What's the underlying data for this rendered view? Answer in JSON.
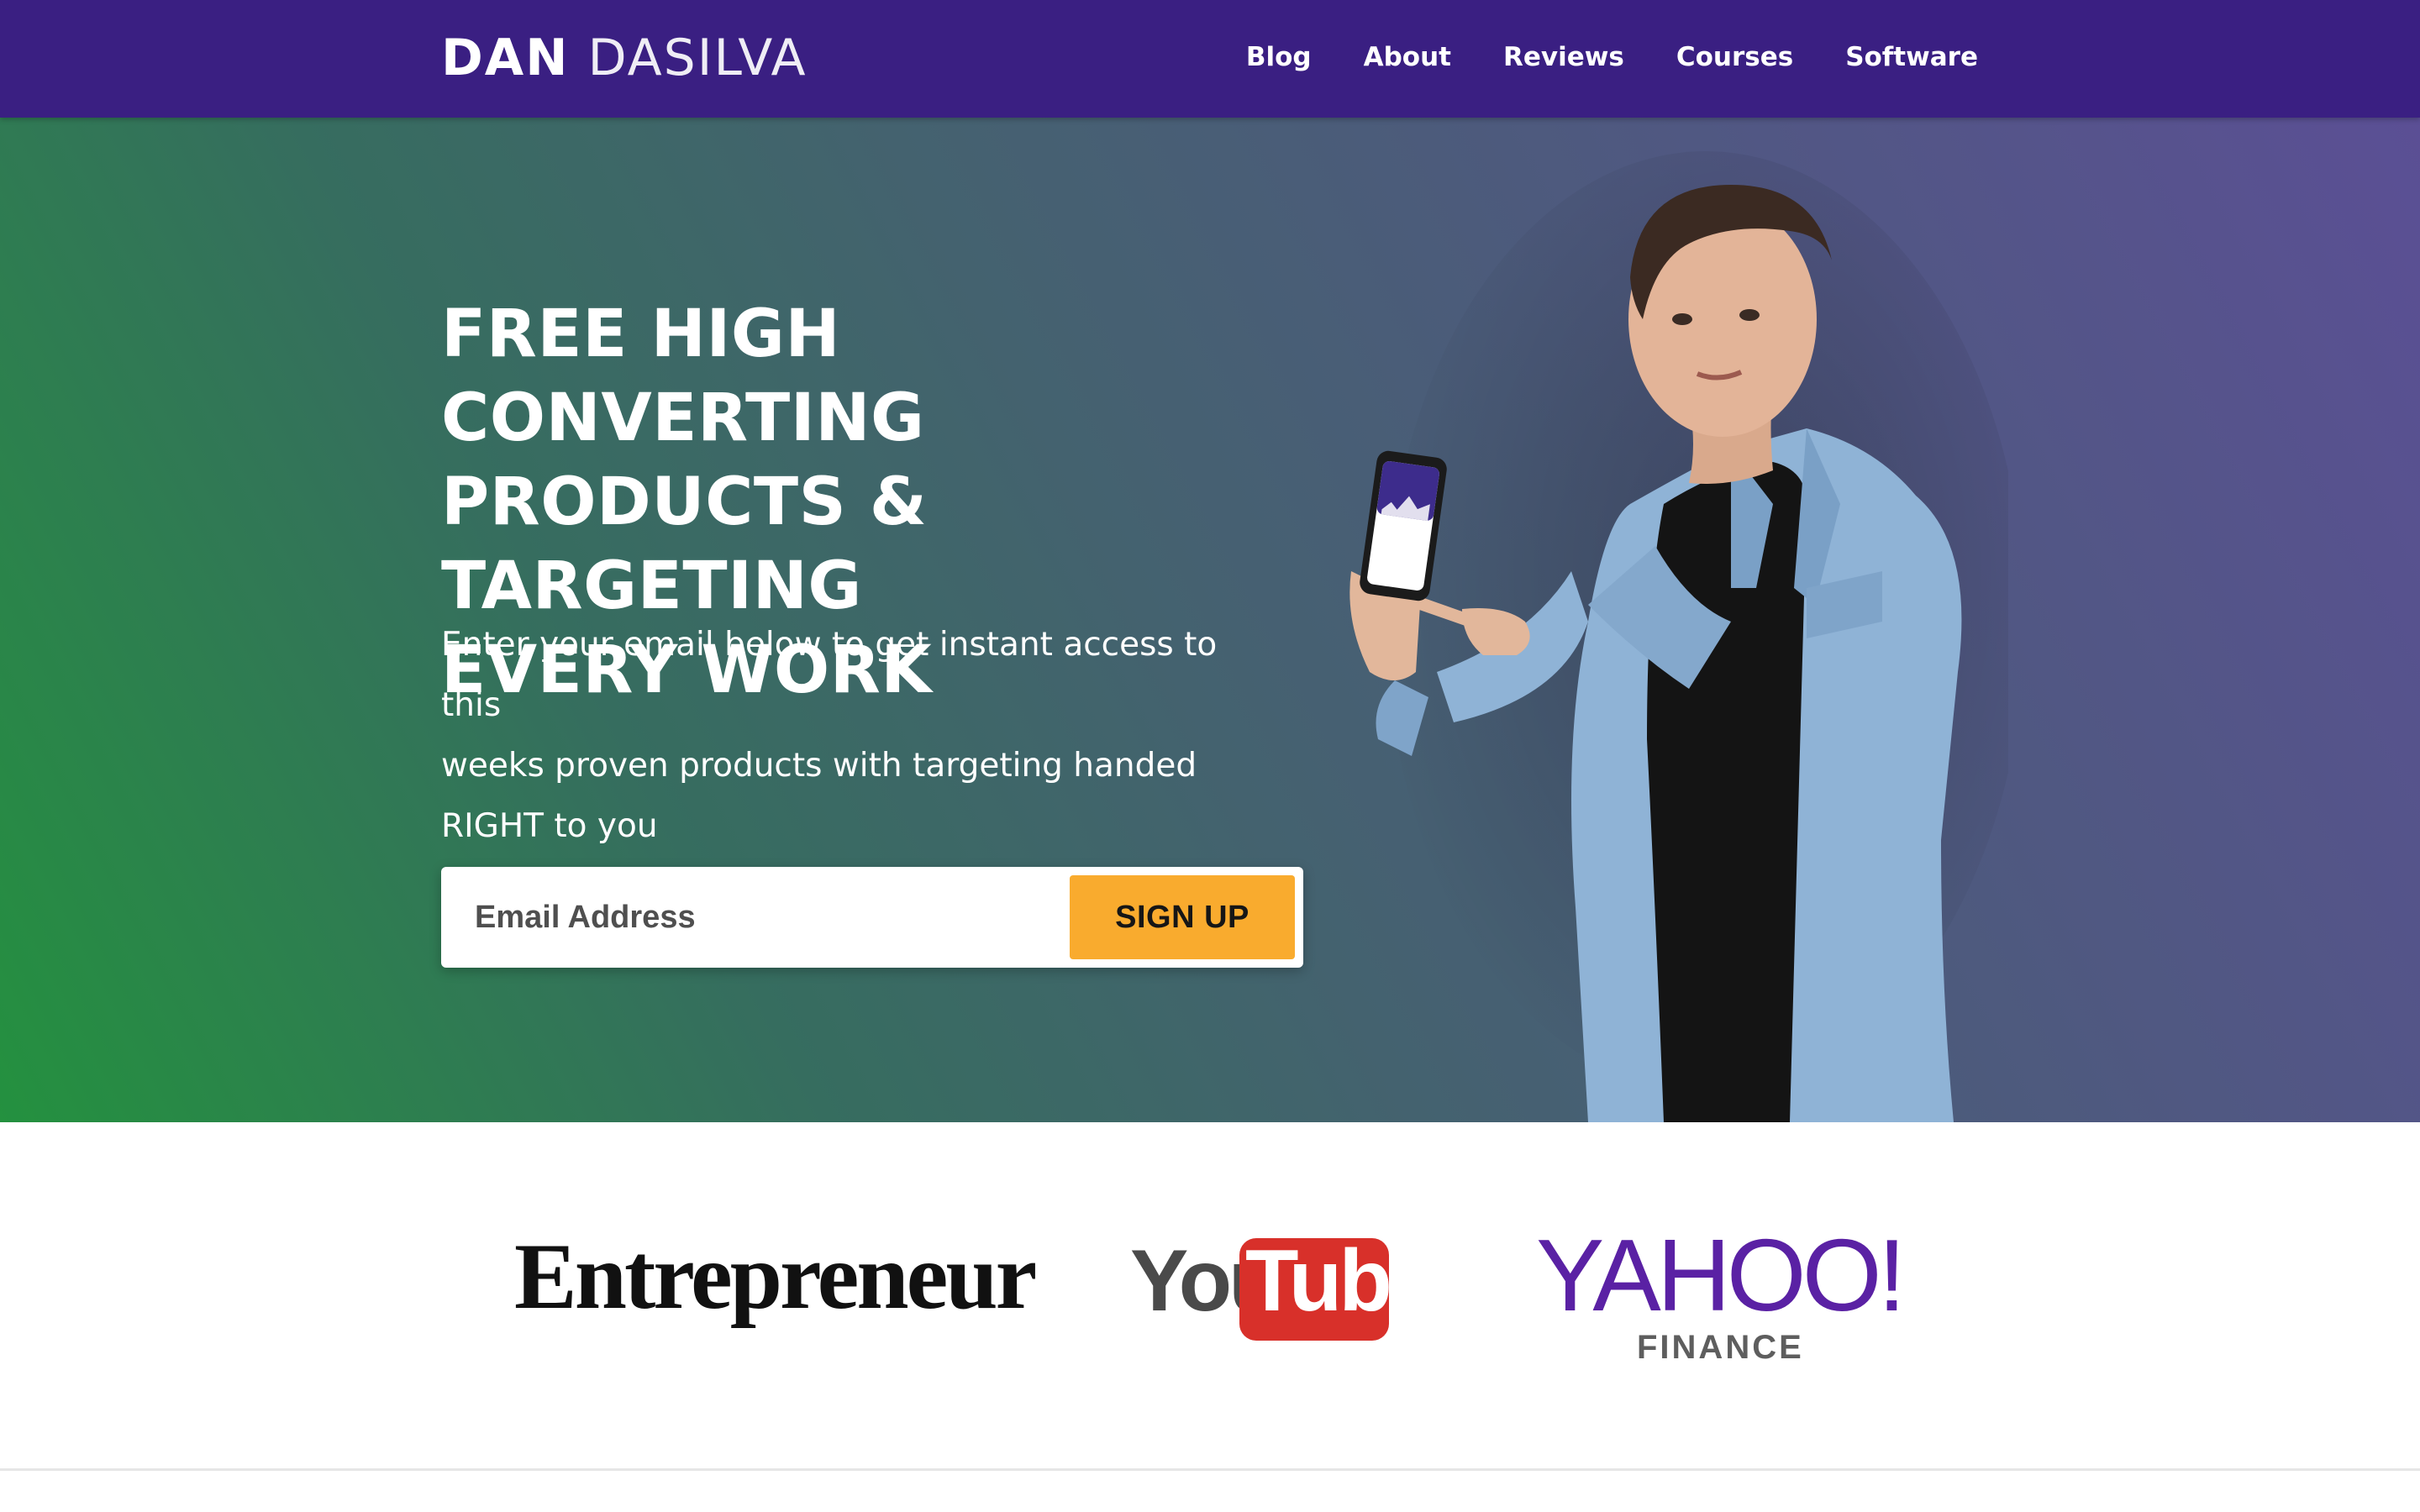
{
  "brand": {
    "first": "DAN",
    "last": "DASILVA"
  },
  "nav": {
    "items": [
      "Blog",
      "About",
      "Reviews",
      "Courses",
      "Software"
    ]
  },
  "hero": {
    "title_lines": [
      "FREE HIGH CONVERTING",
      "PRODUCTS & TARGETING",
      "EVERY WORK"
    ],
    "subtitle_lines": [
      "Enter your email below to get instant access to this",
      "weeks proven products with targeting handed",
      "RIGHT to you"
    ]
  },
  "signup": {
    "email_placeholder": "Email Address",
    "button_label": "SIGN UP"
  },
  "press": {
    "entrepreneur": "Entrepreneur",
    "youtube_you": "You",
    "youtube_tube": "Tube",
    "yahoo": "YAHOO!",
    "yahoo_finance": "FINANCE"
  },
  "colors": {
    "nav_bg": "#3a1f82",
    "cta_button": "#f9ab2e",
    "hero_gradient_left": "#24913f",
    "hero_gradient_right": "#5b4f95",
    "yahoo_purple": "#5a21a4",
    "youtube_red": "#d8302a"
  },
  "icons": {
    "logo_a_glyph": "triangle-a-icon",
    "phone_screen": "phone-chart-icon"
  }
}
